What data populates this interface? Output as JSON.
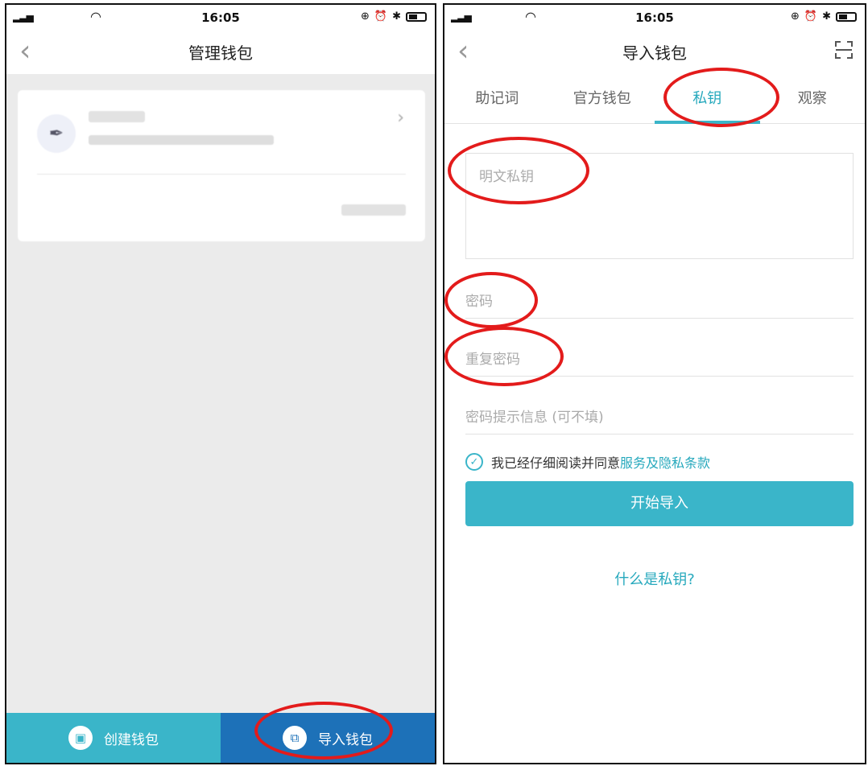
{
  "left_screen": {
    "status": {
      "time": "16:05"
    },
    "nav": {
      "title": "管理钱包"
    },
    "bottom": {
      "create_label": "创建钱包",
      "import_label": "导入钱包"
    }
  },
  "right_screen": {
    "status": {
      "time": "16:05"
    },
    "nav": {
      "title": "导入钱包"
    },
    "tabs": [
      {
        "label": "助记词"
      },
      {
        "label": "官方钱包"
      },
      {
        "label": "私钥"
      },
      {
        "label": "观察"
      }
    ],
    "active_tab": "私钥",
    "form": {
      "private_key_placeholder": "明文私钥",
      "password_placeholder": "密码",
      "repeat_password_placeholder": "重复密码",
      "hint_placeholder": "密码提示信息 (可不填)"
    },
    "agree": {
      "text": "我已经仔细阅读并同意",
      "link": "服务及隐私条款",
      "checked": true
    },
    "start_button": "开始导入",
    "help_link": "什么是私钥?"
  },
  "colors": {
    "accent": "#3ab5c9",
    "accent_text": "#27a9bd",
    "import_bar": "#1d71b8",
    "annotation": "#e31b1b"
  }
}
